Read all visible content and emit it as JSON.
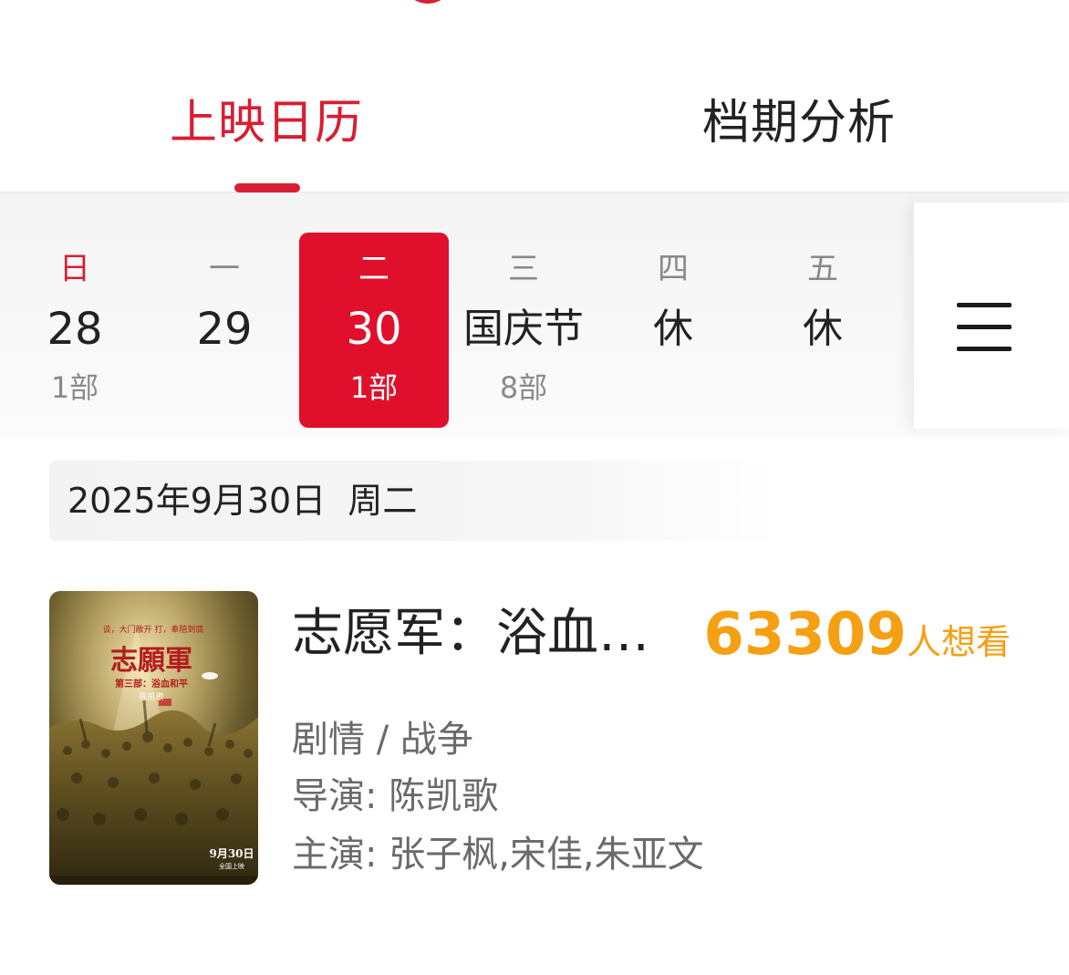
{
  "tabs": {
    "calendar": "上映日历",
    "analysis": "档期分析"
  },
  "days": [
    {
      "weekday": "日",
      "label": "28",
      "count": "1部"
    },
    {
      "weekday": "一",
      "label": "29",
      "count": ""
    },
    {
      "weekday": "二",
      "label": "30",
      "count": "1部"
    },
    {
      "weekday": "三",
      "label": "国庆节",
      "count": "8部"
    },
    {
      "weekday": "四",
      "label": "休",
      "count": ""
    },
    {
      "weekday": "五",
      "label": "休",
      "count": ""
    }
  ],
  "selected_day_index": 2,
  "menu_icon": "hamburger-menu-icon",
  "date_header": "2025年9月30日  周二",
  "movie": {
    "title": "志愿军：浴血…",
    "want_count": "63309",
    "want_label": "人想看",
    "genre": "剧情 / 战争",
    "director": "导演: 陈凯歌",
    "cast": "主演: 张子枫,宋佳,朱亚文",
    "poster": {
      "title_art": "志願軍",
      "subtitle_art": "第三部：浴血和平",
      "director_art": "陈凯歌",
      "tagline_art": "谈，大门敞开 打，奉陪到底",
      "release_art": "9月30日",
      "release_sub_art": "全国上映"
    }
  },
  "colors": {
    "accent_red": "#d81e32",
    "selected_bg": "#e0102c",
    "want_orange": "#f5a013"
  }
}
